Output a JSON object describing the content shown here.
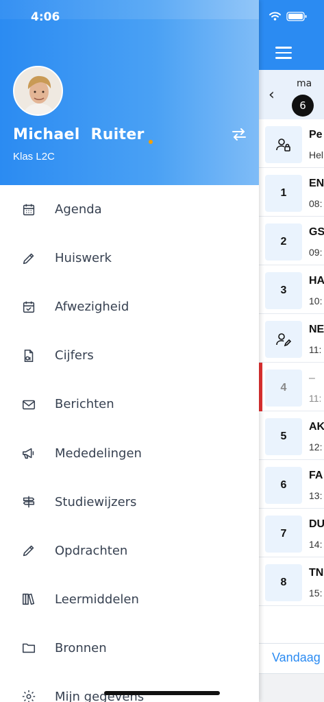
{
  "status_bar": {
    "time": "4:06"
  },
  "user": {
    "first_name": "Michael",
    "last_name": "Ruiter",
    "class": "Klas L2C"
  },
  "menu": [
    {
      "label": "Agenda",
      "icon": "calendar-icon"
    },
    {
      "label": "Huiswerk",
      "icon": "pencil-icon"
    },
    {
      "label": "Afwezigheid",
      "icon": "calendar-check-icon"
    },
    {
      "label": "Cijfers",
      "icon": "grade-document-icon"
    },
    {
      "label": "Berichten",
      "icon": "envelope-icon"
    },
    {
      "label": "Mededelingen",
      "icon": "megaphone-icon"
    },
    {
      "label": "Studiewijzers",
      "icon": "signpost-icon"
    },
    {
      "label": "Opdrachten",
      "icon": "pencil-icon"
    },
    {
      "label": "Leermiddelen",
      "icon": "books-icon"
    },
    {
      "label": "Bronnen",
      "icon": "folder-icon"
    },
    {
      "label": "Mijn gegevens",
      "icon": "gear-icon"
    }
  ],
  "agenda": {
    "day_label": "ma",
    "day_number": "6",
    "lessons": [
      {
        "badge": "",
        "badge_icon": "person-lock-icon",
        "title": "Pe",
        "sub": "Hel"
      },
      {
        "badge": "1",
        "title": "EN",
        "sub": "08:"
      },
      {
        "badge": "2",
        "title": "GS",
        "sub": "09:"
      },
      {
        "badge": "3",
        "title": "HA",
        "sub": "10:"
      },
      {
        "badge": "",
        "badge_icon": "person-edit-icon",
        "title": "NE",
        "sub": "11:"
      },
      {
        "badge": "4",
        "title": "–",
        "sub": "11:",
        "current": true
      },
      {
        "badge": "5",
        "title": "AK",
        "sub": "12:"
      },
      {
        "badge": "6",
        "title": "FA",
        "sub": "13:"
      },
      {
        "badge": "7",
        "title": "DU",
        "sub": "14:"
      },
      {
        "badge": "8",
        "title": "TN",
        "sub": "15:"
      }
    ],
    "today_label": "Vandaag"
  },
  "colors": {
    "accent": "#2b8bf2",
    "current_marker": "#e03131",
    "name_dot": "#f59f00"
  }
}
